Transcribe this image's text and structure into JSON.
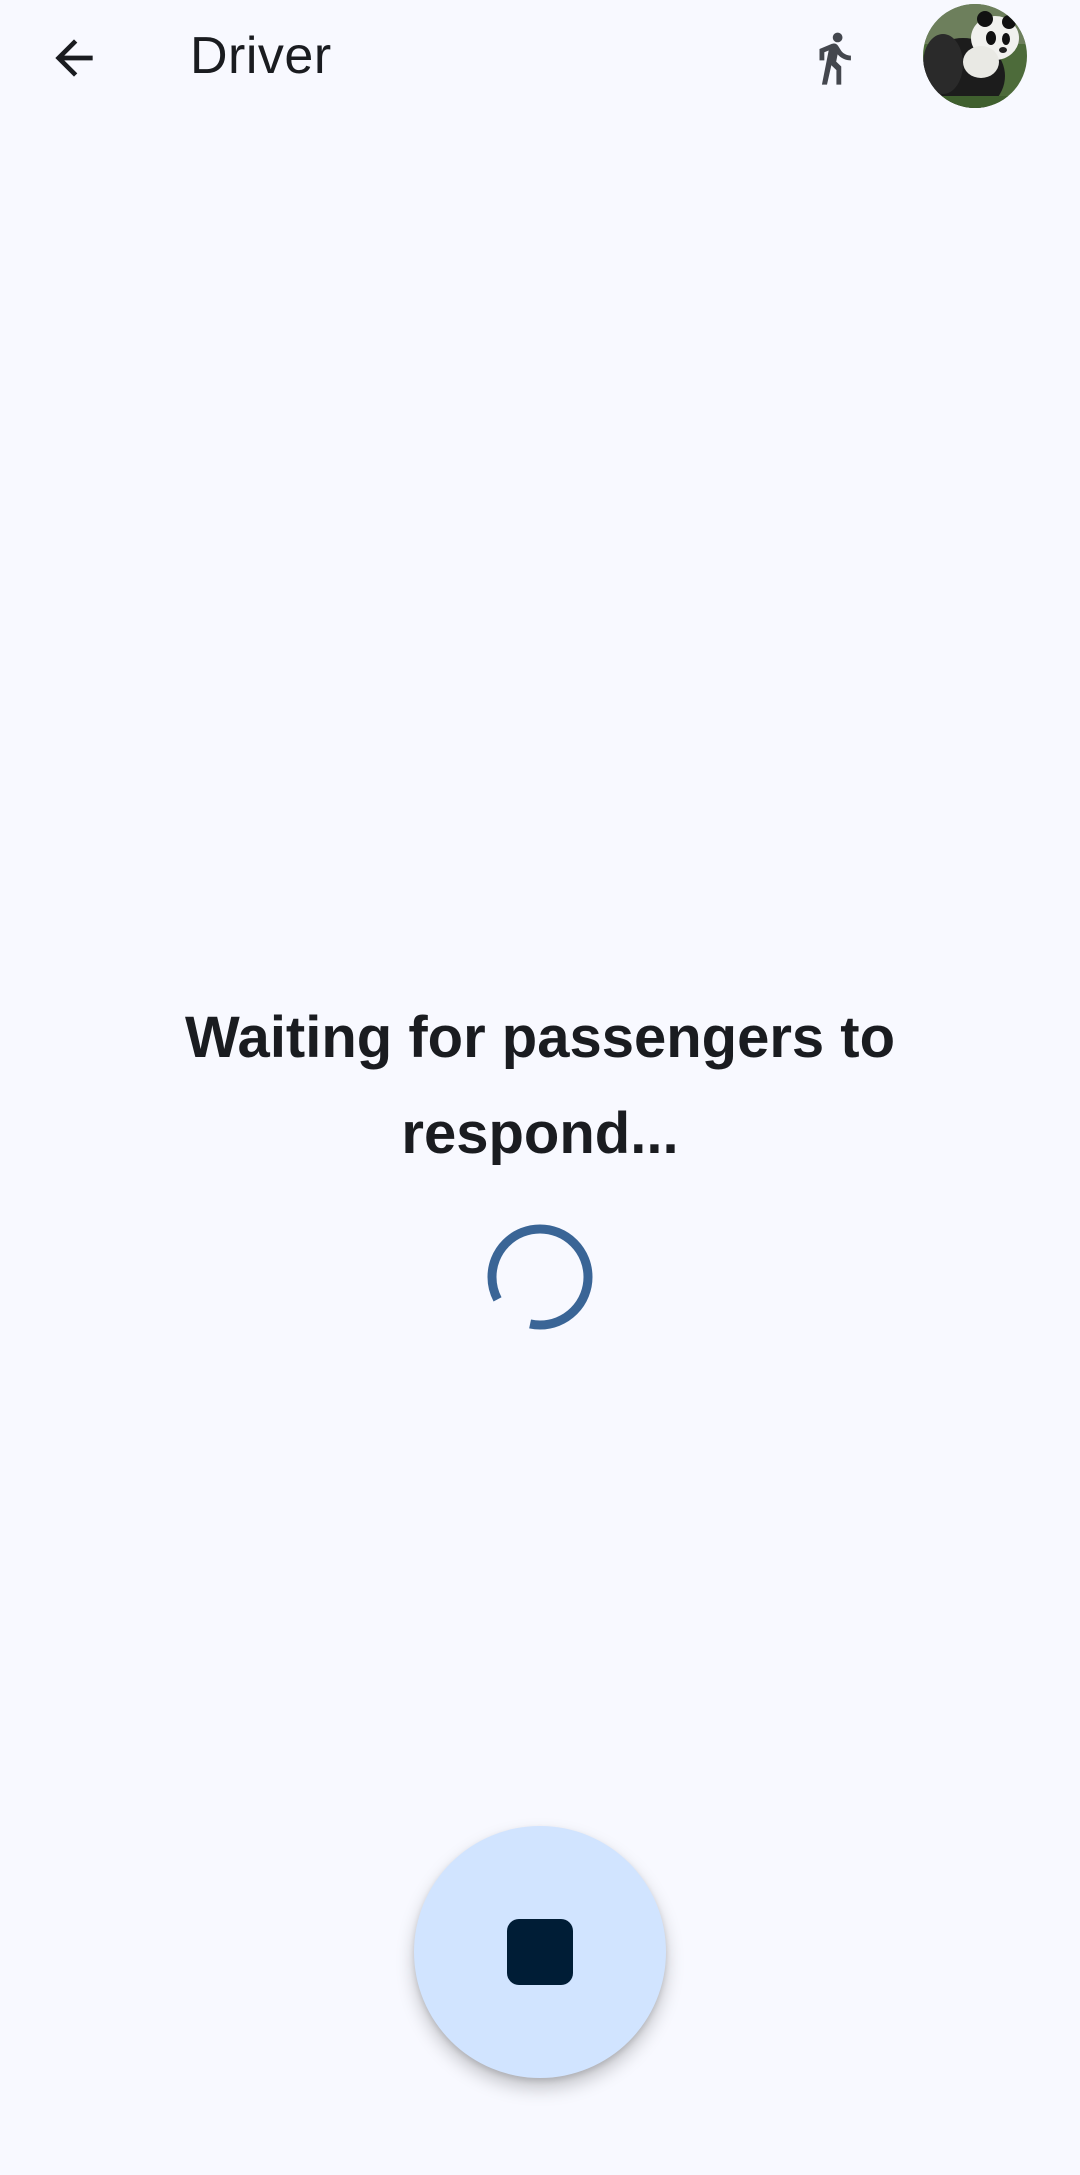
{
  "app_bar": {
    "title": "Driver",
    "back_icon": "arrow-left-icon",
    "mode_icon": "walking-person-icon",
    "avatar_alt": "panda"
  },
  "main": {
    "status_text": "Waiting for passengers to respond...",
    "spinner_icon": "progress-spinner"
  },
  "fab": {
    "icon": "stop-icon"
  },
  "colors": {
    "background": "#f8f9ff",
    "text": "#1a1c20",
    "spinner": "#3a6596",
    "fab_background": "#d1e4ff",
    "fab_icon": "#001d36"
  }
}
